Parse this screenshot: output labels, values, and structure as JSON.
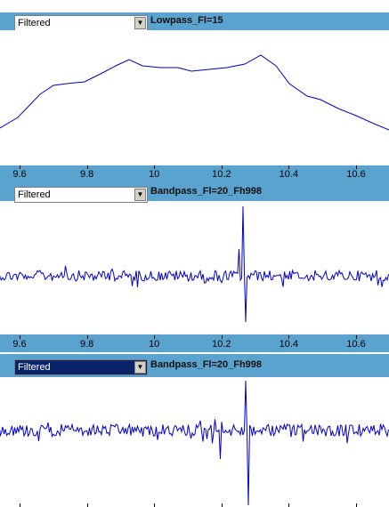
{
  "panels": [
    {
      "filter_mode": "Filtered",
      "title": "Lowpass_Fl=15",
      "active": false
    },
    {
      "filter_mode": "Filtered",
      "title": "Bandpass_Fl=20_Fh998",
      "active": false
    },
    {
      "filter_mode": "Filtered",
      "title": "Bandpass_Fl=20_Fh998",
      "active": true
    }
  ],
  "axis": {
    "ticks": [
      "9.6",
      "9.8",
      "10",
      "10.2",
      "10.4",
      "10.6"
    ],
    "tick_values": [
      9.6,
      9.8,
      10.0,
      10.2,
      10.4,
      10.6
    ],
    "xlim": [
      9.54,
      10.7
    ]
  },
  "colors": {
    "trace": "#0000c8",
    "header": "#5aa3cf"
  }
}
